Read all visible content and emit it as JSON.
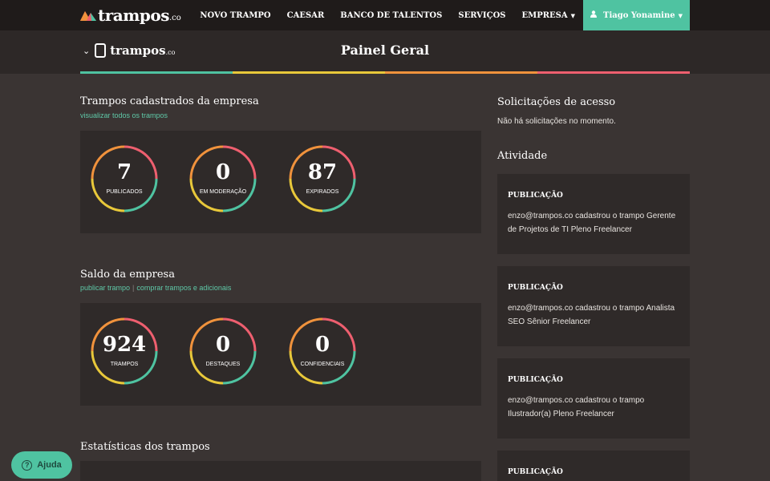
{
  "brand": {
    "name": "trampos",
    "suffix": ".co"
  },
  "nav": {
    "items": [
      "NOVO TRAMPO",
      "CAESAR",
      "BANCO DE TALENTOS",
      "SERVIÇOS",
      "EMPRESA"
    ],
    "user": "Tiago Yonamine"
  },
  "subheader": {
    "title": "Painel Geral",
    "logo_text": "trampos",
    "logo_suffix": ".co"
  },
  "colors": {
    "teal": "#4fc3a1",
    "yellow": "#e8c83a",
    "orange": "#f0923c",
    "pink": "#ee5f6f",
    "link": "#5fc9a8"
  },
  "jobs_section": {
    "title": "Trampos cadastrados da empresa",
    "link": "visualizar todos os trampos",
    "stats": [
      {
        "value": "7",
        "label": "PUBLICADOS"
      },
      {
        "value": "0",
        "label": "EM MODERAÇÃO"
      },
      {
        "value": "87",
        "label": "EXPIRADOS"
      }
    ]
  },
  "balance_section": {
    "title": "Saldo da empresa",
    "link1": "publicar trampo",
    "separator": "|",
    "link2": "comprar trampos e adicionais",
    "stats": [
      {
        "value": "924",
        "label": "TRAMPOS"
      },
      {
        "value": "0",
        "label": "DESTAQUES"
      },
      {
        "value": "0",
        "label": "CONFIDENCIAIS"
      }
    ]
  },
  "stats_section": {
    "title": "Estatísticas dos trampos"
  },
  "access": {
    "title": "Solicitações de acesso",
    "empty": "Não há solicitações no momento."
  },
  "activity": {
    "title": "Atividade",
    "items": [
      {
        "type": "PUBLICAÇÃO",
        "text": "enzo@trampos.co cadastrou o trampo Gerente de Projetos de TI Pleno Freelancer"
      },
      {
        "type": "PUBLICAÇÃO",
        "text": "enzo@trampos.co cadastrou o trampo Analista SEO Sênior Freelancer"
      },
      {
        "type": "PUBLICAÇÃO",
        "text": "enzo@trampos.co cadastrou o trampo Ilustrador(a) Pleno Freelancer"
      },
      {
        "type": "PUBLICAÇÃO",
        "text": ""
      }
    ]
  },
  "help": {
    "label": "Ajuda"
  },
  "icons": {
    "logo": "trampos-logo-icon",
    "user": "user-icon",
    "caret": "caret-down-icon",
    "help": "question-icon"
  }
}
